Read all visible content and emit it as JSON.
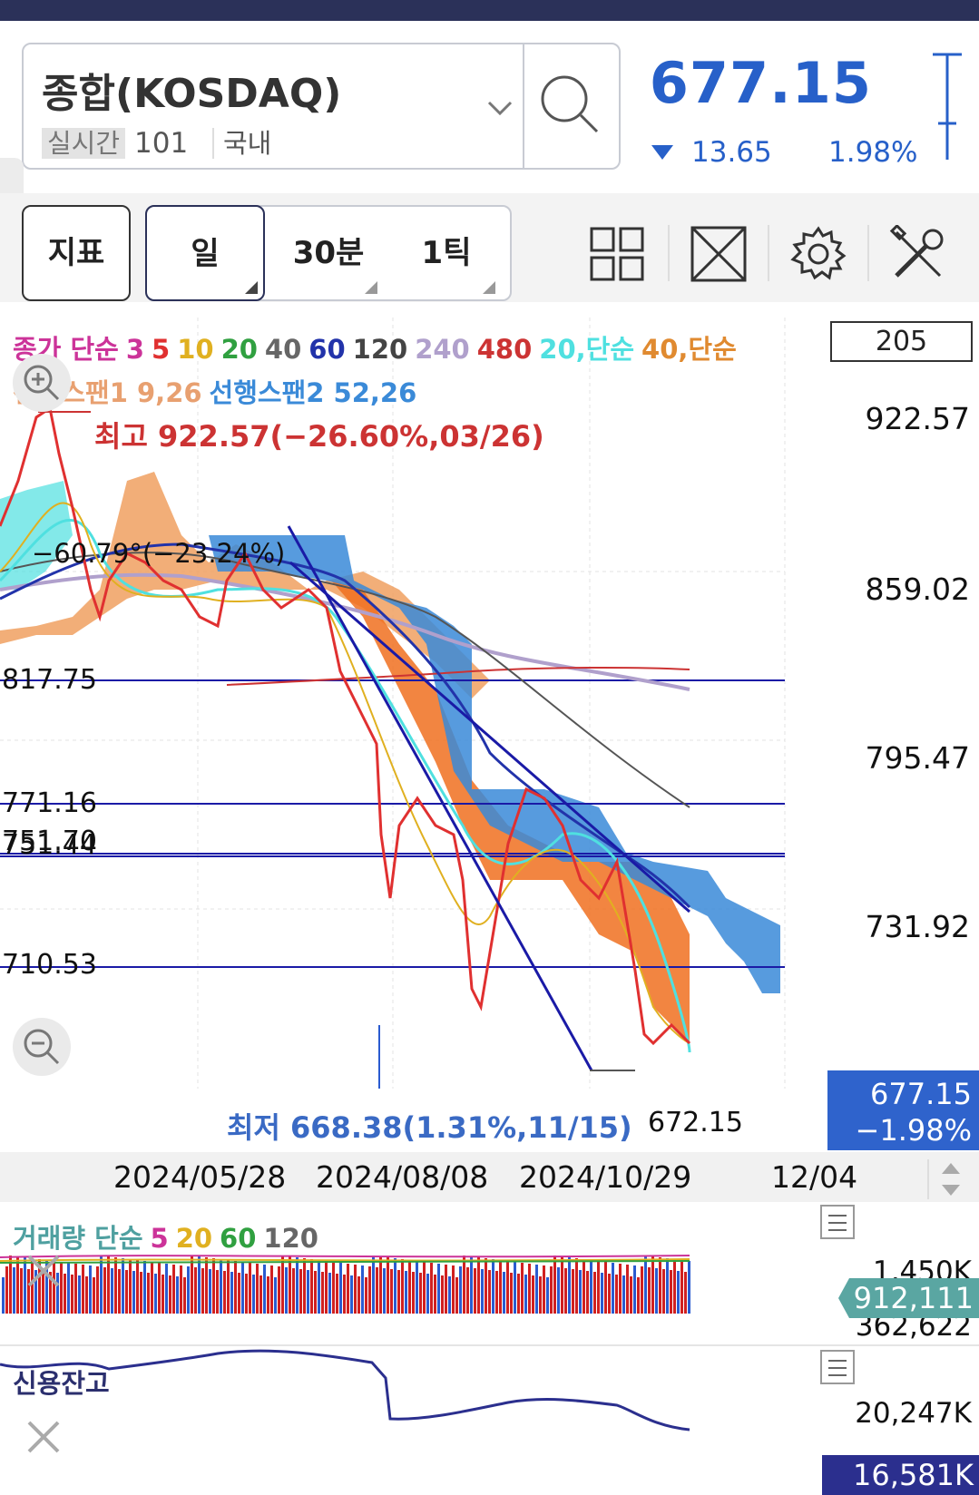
{
  "header": {
    "symbol_name": "종합(KOSDAQ)",
    "realtime_badge": "실시간",
    "code": "101",
    "market": "국내",
    "price": "677.15",
    "change_value": "13.65",
    "change_pct": "1.98%",
    "change_direction": "down",
    "price_color": "#2760c9"
  },
  "toolbar": {
    "indicator_label": "지표",
    "periods": [
      "일",
      "30분",
      "1틱"
    ],
    "selected_period": "일",
    "tools": [
      "layout-grid-icon",
      "fullscreen-icon",
      "gear-icon",
      "tools-icon"
    ]
  },
  "chart": {
    "legend_line1": [
      {
        "text": "종가 단순",
        "color": "#cc3399"
      },
      {
        "text": "3",
        "color": "#cc3399"
      },
      {
        "text": "5",
        "color": "#e03030"
      },
      {
        "text": "10",
        "color": "#e0b020"
      },
      {
        "text": "20",
        "color": "#30a040"
      },
      {
        "text": "40",
        "color": "#666666"
      },
      {
        "text": "60",
        "color": "#2233aa"
      },
      {
        "text": "120",
        "color": "#444444"
      },
      {
        "text": "240",
        "color": "#b0a0cc"
      },
      {
        "text": "480",
        "color": "#cc3333"
      },
      {
        "text": "20,단순",
        "color": "#4fe0e0"
      },
      {
        "text": "40,단순",
        "color": "#e08a30"
      }
    ],
    "legend_line2": [
      {
        "text": "선행스팬1 9,26",
        "color": "#e8a070"
      },
      {
        "text": "선행스팬2 52,26",
        "color": "#3a8ad8"
      }
    ],
    "count": "205",
    "high_label": "최고 922.57(−26.60%,03/26)",
    "low_label": "최저 668.38(1.31%,11/15)",
    "angle_label": "−60.79°(−23.24%)",
    "last_label": "672.15",
    "price_tag_value": "677.15",
    "price_tag_pct": "−1.98%",
    "y_axis_labels": [
      "922.57",
      "859.02",
      "795.47",
      "731.92"
    ],
    "horizontal_lines": [
      "817.75",
      "771.16",
      "751.70",
      "751.44",
      "710.53"
    ],
    "horizontal_line_overlap_text": "751.70",
    "horizontal_line_color": "#1a1aa6"
  },
  "chart_data": {
    "type": "line",
    "title": "",
    "x": [
      "2024/05/28",
      "2024/08/08",
      "2024/10/29",
      "12/04"
    ],
    "series": [],
    "ylim": [
      668.38,
      922.57
    ],
    "high": 922.57,
    "low": 668.38,
    "last": 677.15
  },
  "date_axis": [
    "2024/05/28",
    "2024/08/08",
    "2024/10/29",
    "12/04"
  ],
  "volume": {
    "legend": [
      {
        "text": "거래량 단순",
        "color": "#4fa0a0"
      },
      {
        "text": "5",
        "color": "#cc3399"
      },
      {
        "text": "20",
        "color": "#e0b020"
      },
      {
        "text": "60",
        "color": "#30a040"
      },
      {
        "text": "120",
        "color": "#666666"
      }
    ],
    "max": "1,450K",
    "min": "362,622",
    "current": "912,111"
  },
  "credit": {
    "legend": "신용잔고",
    "max": "20,247K",
    "current": "16,581K"
  }
}
